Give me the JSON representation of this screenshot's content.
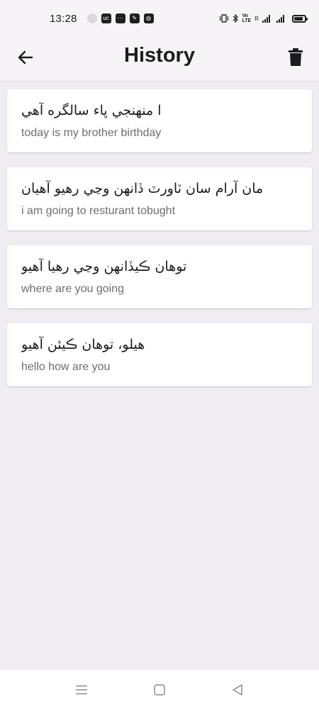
{
  "status_bar": {
    "time": "13:28",
    "notif_icons": [
      "circle-icon",
      "uc-browser-icon",
      "chat-icon",
      "edit-app-icon",
      "globe-icon"
    ],
    "right_icons": [
      "vibrate-icon",
      "bluetooth-icon",
      "volte-icon",
      "signal-icon",
      "battery-icon"
    ],
    "vo_label_top": "Vo",
    "vo_label_bottom": "LTE",
    "r_label": "R"
  },
  "app_bar": {
    "title": "History",
    "back_icon": "arrow-left-icon",
    "delete_icon": "trash-icon"
  },
  "history": [
    {
      "source": "ا منهنجي ڀاء سالگره آهي",
      "target": "today is my brother birthday"
    },
    {
      "source": "مان آرام سان ٽاورٽ ڏانهن وڃي رهيو آهيان",
      "target": "i am going to resturant tobught"
    },
    {
      "source": "توهان ڪيڏانهن وڃي رهيا آهيو",
      "target": "where are you going"
    },
    {
      "source": "هيلو، توهان ڪيئن آهيو",
      "target": "hello how are you"
    }
  ],
  "nav_bar": {
    "icons": [
      "menu-icon",
      "home-square-icon",
      "back-triangle-icon"
    ]
  },
  "colors": {
    "background": "#efedf1",
    "surface": "#ffffff",
    "title_text": "#1c1b1f",
    "secondary_text": "#6e6c70"
  }
}
